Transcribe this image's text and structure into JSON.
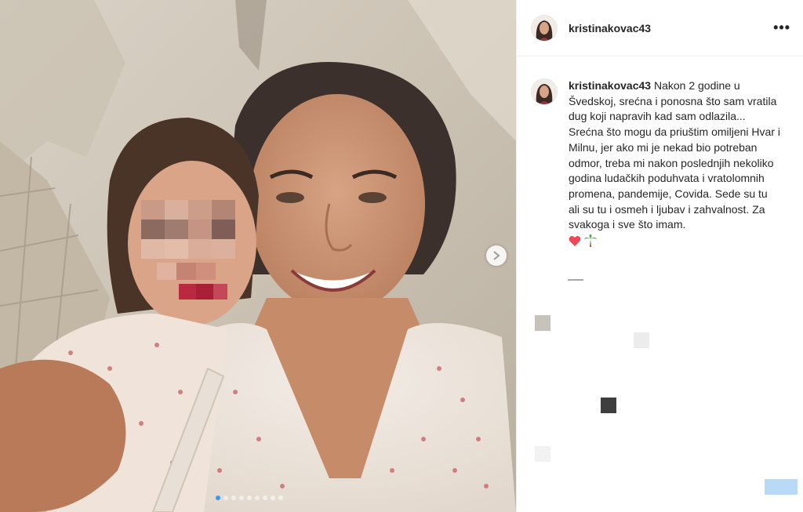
{
  "post": {
    "username": "kristinakovac43",
    "caption": {
      "username": "kristinakovac43",
      "text": "Nakon 2 godine u Švedskoj, srećna i ponosna što sam vratila dug koji napravih kad sam odlazila... Srećna što mogu da priuštim omiljeni Hvar i Milnu, jer ako mi je nekad bio potreban odmor, treba mi nakon poslednjih nekoliko godina ludačkih poduhvata i vratolomnih promena, pandemije, Covida. Sede su tu ali su tu i osmeh i ljubav i zahvalnost. Za svakoga i sve što imam."
    },
    "emojis": [
      "heart-emoji",
      "palm-tree-emoji"
    ],
    "more_label": "•••",
    "carousel": {
      "total_slides": 9,
      "active_index": 0
    }
  },
  "colors": {
    "text": "#262626",
    "border": "#efefef",
    "active_dot": "#3897f0",
    "heart": "#ed4956"
  }
}
